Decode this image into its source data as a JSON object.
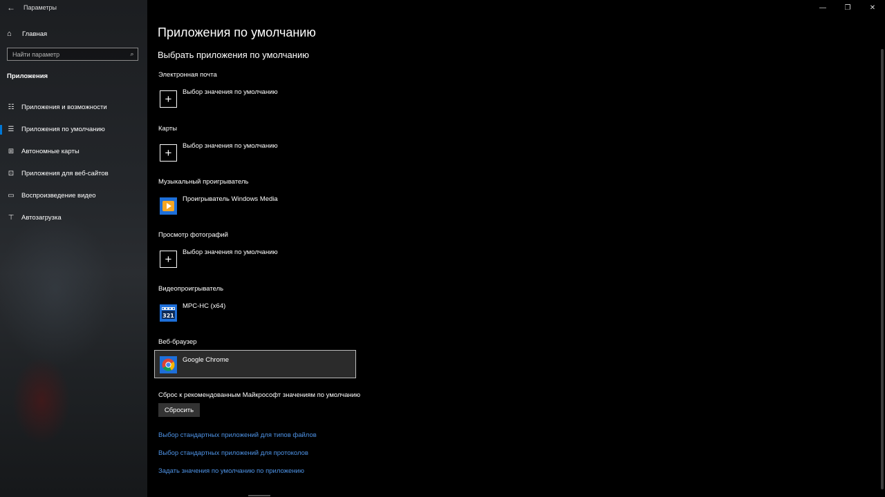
{
  "window": {
    "title": "Параметры",
    "controls": {
      "minimize": "—",
      "restore": "❐",
      "close": "✕"
    }
  },
  "sidebar": {
    "back_icon": "←",
    "home": {
      "icon": "⌂",
      "label": "Главная"
    },
    "search": {
      "placeholder": "Найти параметр",
      "icon": "⌕"
    },
    "section_title": "Приложения",
    "items": [
      {
        "icon": "☷",
        "label": "Приложения и возможности"
      },
      {
        "icon": "☰",
        "label": "Приложения по умолчанию",
        "selected": true
      },
      {
        "icon": "⊞",
        "label": "Автономные карты"
      },
      {
        "icon": "⊡",
        "label": "Приложения для веб-сайтов"
      },
      {
        "icon": "▭",
        "label": "Воспроизведение видео"
      },
      {
        "icon": "⊤",
        "label": "Автозагрузка"
      }
    ]
  },
  "main": {
    "title": "Приложения по умолчанию",
    "subtitle": "Выбрать приложения по умолчанию",
    "categories": [
      {
        "label": "Электронная почта",
        "app": "Выбор значения по умолчанию",
        "icon": "plus-icon"
      },
      {
        "label": "Карты",
        "app": "Выбор значения по умолчанию",
        "icon": "plus-icon"
      },
      {
        "label": "Музыкальный проигрыватель",
        "app": "Проигрыватель Windows Media",
        "icon": "windows-media-player-icon"
      },
      {
        "label": "Просмотр фотографий",
        "app": "Выбор значения по умолчанию",
        "icon": "plus-icon"
      },
      {
        "label": "Видеопроигрыватель",
        "app": "MPC-HC (x64)",
        "icon": "mpc-hc-icon"
      },
      {
        "label": "Веб-браузер",
        "app": "Google Chrome",
        "icon": "chrome-icon"
      }
    ],
    "reset": {
      "label": "Сброс к рекомендованным Майкрософт значениям по умолчанию",
      "button": "Сбросить"
    },
    "links": [
      "Выбор стандартных приложений для типов файлов",
      "Выбор стандартных приложений для протоколов",
      "Задать значения по умолчанию по приложению"
    ]
  }
}
